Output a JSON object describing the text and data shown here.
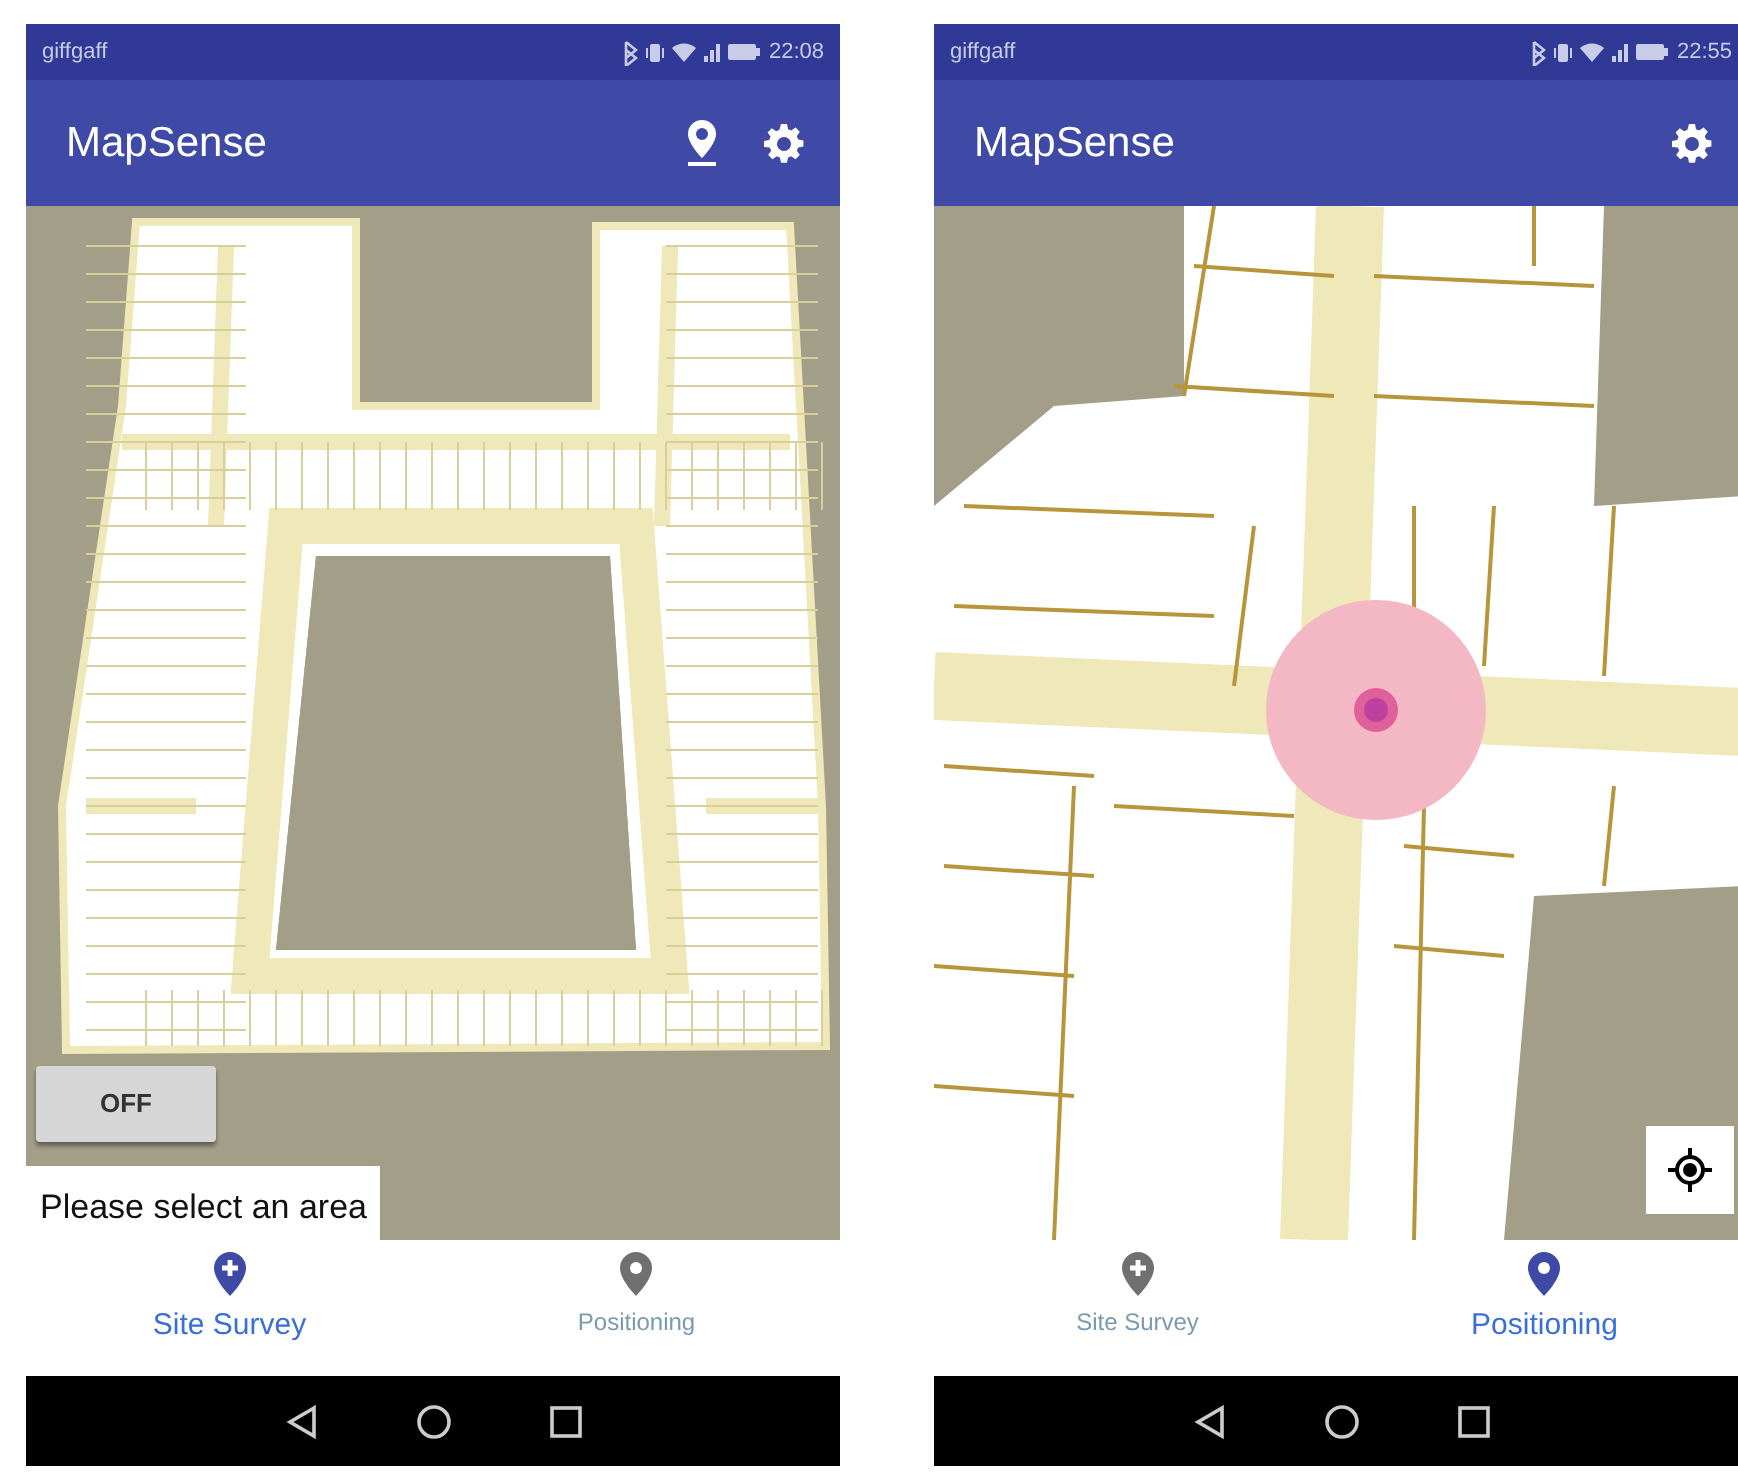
{
  "screens": [
    {
      "status_bar": {
        "carrier": "giffgaff",
        "time": "22:08"
      },
      "app_bar": {
        "title": "MapSense",
        "actions": [
          {
            "kind": "location"
          },
          {
            "kind": "settings"
          }
        ]
      },
      "map": {
        "kind": "floorplan",
        "toggle": {
          "label": "OFF"
        },
        "message": "Please select an area"
      },
      "bottom_nav": [
        {
          "label": "Site Survey",
          "kind": "survey",
          "selected": true
        },
        {
          "label": "Positioning",
          "kind": "positioning",
          "selected": false
        }
      ]
    },
    {
      "status_bar": {
        "carrier": "giffgaff",
        "time": "22:55"
      },
      "app_bar": {
        "title": "MapSense",
        "actions": [
          {
            "kind": "settings"
          }
        ]
      },
      "map": {
        "kind": "zoomed",
        "position_marker": true,
        "locate_button": true
      },
      "bottom_nav": [
        {
          "label": "Site Survey",
          "kind": "survey",
          "selected": false
        },
        {
          "label": "Positioning",
          "kind": "positioning",
          "selected": true
        }
      ]
    }
  ]
}
